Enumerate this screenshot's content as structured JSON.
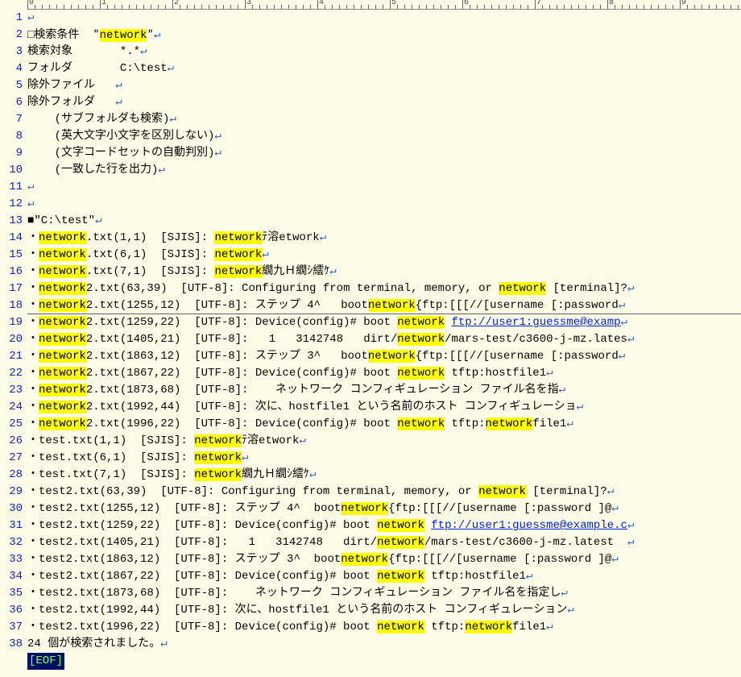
{
  "search_header": {
    "label_condition": "□検索条件",
    "keyword": "network",
    "label_target": "検索対象",
    "target_value": "*.*",
    "label_folder": "フォルダ",
    "folder_value": "C:\\test",
    "label_exclude_file": "除外ファイル",
    "label_exclude_folder": "除外フォルダ",
    "opt1": "(サブフォルダも検索)",
    "opt2": "(英大文字小文字を区別しない)",
    "opt3": "(文字コードセットの自動判別)",
    "opt4": "(一致した行を出力)"
  },
  "folder_marker": "■\"C:\\test\"",
  "results": [
    {
      "pre": "・",
      "hl1": "network",
      "mid": ".txt(1,1)  [SJIS]: ",
      "hl2": "network",
      "post": "ﾃ溶etwork"
    },
    {
      "pre": "・",
      "hl1": "network",
      "mid": ".txt(6,1)  [SJIS]: ",
      "hl2": "network",
      "post": ""
    },
    {
      "pre": "・",
      "hl1": "network",
      "mid": ".txt(7,1)  [SJIS]: ",
      "hl2": "network",
      "post": "繝九Ｈ繝ｼ繧ｹ"
    },
    {
      "pre": "・",
      "hl1": "network",
      "mid": "2.txt(63,39)  [UTF-8]: Configuring from terminal, memory, or ",
      "hl2": "network",
      "post": " [terminal]?"
    },
    {
      "pre": "・",
      "hl1": "network",
      "mid": "2.txt(1255,12)  [UTF-8]: ステップ 4^   boot",
      "hl2": "network",
      "post": "{ftp:[[[//[username [:password"
    },
    {
      "pre": "・",
      "hl1": "network",
      "mid": "2.txt(1259,22)  [UTF-8]: Device(config)# boot ",
      "hl2": "network",
      "post": " ",
      "link": "ftp://user1:guessme@examp"
    },
    {
      "pre": "・",
      "hl1": "network",
      "mid": "2.txt(1405,21)  [UTF-8]:   1   3142748   dirt/",
      "hl2": "network",
      "post": "/mars-test/c3600-j-mz.lates"
    },
    {
      "pre": "・",
      "hl1": "network",
      "mid": "2.txt(1863,12)  [UTF-8]: ステップ 3^   boot",
      "hl2": "network",
      "post": "{ftp:[[[//[username [:password"
    },
    {
      "pre": "・",
      "hl1": "network",
      "mid": "2.txt(1867,22)  [UTF-8]: Device(config)# boot ",
      "hl2": "network",
      "post": " tftp:hostfile1"
    },
    {
      "pre": "・",
      "hl1": "network",
      "mid": "2.txt(1873,68)  [UTF-8]:    ネットワーク コンフィギュレーション ファイル名を指"
    },
    {
      "pre": "・",
      "hl1": "network",
      "mid": "2.txt(1992,44)  [UTF-8]: 次に、hostfile1 という名前のホスト コンフィギュレーショ"
    },
    {
      "pre": "・",
      "hl1": "network",
      "mid": "2.txt(1996,22)  [UTF-8]: Device(config)# boot ",
      "hl2": "network",
      "post": " tftp:",
      "hl3": "network",
      "post2": "file1"
    },
    {
      "pre": "・test.txt(1,1)  [SJIS]: ",
      "hl2": "network",
      "post": "ﾃ溶etwork"
    },
    {
      "pre": "・test.txt(6,1)  [SJIS]: ",
      "hl2": "network",
      "post": ""
    },
    {
      "pre": "・test.txt(7,1)  [SJIS]: ",
      "hl2": "network",
      "post": "繝九Ｈ繝ｼ繧ｹ"
    },
    {
      "pre": "・test2.txt(63,39)  [UTF-8]: Configuring from terminal, memory, or ",
      "hl2": "network",
      "post": " [terminal]?"
    },
    {
      "pre": "・test2.txt(1255,12)  [UTF-8]: ステップ 4^  boot",
      "hl2": "network",
      "post": "{ftp:[[[//[username [:password ]@"
    },
    {
      "pre": "・test2.txt(1259,22)  [UTF-8]: Device(config)# boot ",
      "hl2": "network",
      "post": " ",
      "link": "ftp://user1:guessme@example.c"
    },
    {
      "pre": "・test2.txt(1405,21)  [UTF-8]:   1   3142748   dirt/",
      "hl2": "network",
      "post": "/mars-test/c3600-j-mz.latest  "
    },
    {
      "pre": "・test2.txt(1863,12)  [UTF-8]: ステップ 3^  boot",
      "hl2": "network",
      "post": "{ftp:[[[//[username [:password ]@"
    },
    {
      "pre": "・test2.txt(1867,22)  [UTF-8]: Device(config)# boot ",
      "hl2": "network",
      "post": " tftp:hostfile1"
    },
    {
      "pre": "・test2.txt(1873,68)  [UTF-8]:    ネットワーク コンフィギュレーション ファイル名を指定し"
    },
    {
      "pre": "・test2.txt(1992,44)  [UTF-8]: 次に、hostfile1 という名前のホスト コンフィギュレーション"
    },
    {
      "pre": "・test2.txt(1996,22)  [UTF-8]: Device(config)# boot ",
      "hl2": "network",
      "post": " tftp:",
      "hl3": "network",
      "post2": "file1"
    }
  ],
  "summary": "24 個が検索されました。",
  "eof": "[EOF]",
  "quote": "\"",
  "newline": "↵"
}
